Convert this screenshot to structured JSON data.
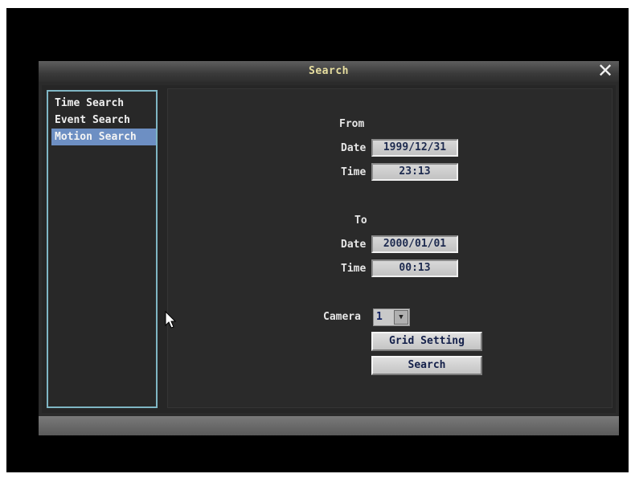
{
  "window": {
    "title": "Search",
    "close_glyph": "✕"
  },
  "sidebar": {
    "items": [
      {
        "label": "Time Search",
        "selected": false
      },
      {
        "label": "Event Search",
        "selected": false
      },
      {
        "label": "Motion Search",
        "selected": true
      }
    ]
  },
  "form": {
    "from_label": "From",
    "from_date_label": "Date",
    "from_date_value": "1999/12/31",
    "from_time_label": "Time",
    "from_time_value": "23:13",
    "to_label": "To",
    "to_date_label": "Date",
    "to_date_value": "2000/01/01",
    "to_time_label": "Time",
    "to_time_value": "00:13",
    "camera_label": "Camera",
    "camera_value": "1",
    "grid_button": "Grid Setting",
    "search_button": "Search"
  },
  "icons": {
    "dropdown_arrow": "chevron-down-icon",
    "cursor": "mouse-pointer-icon"
  }
}
